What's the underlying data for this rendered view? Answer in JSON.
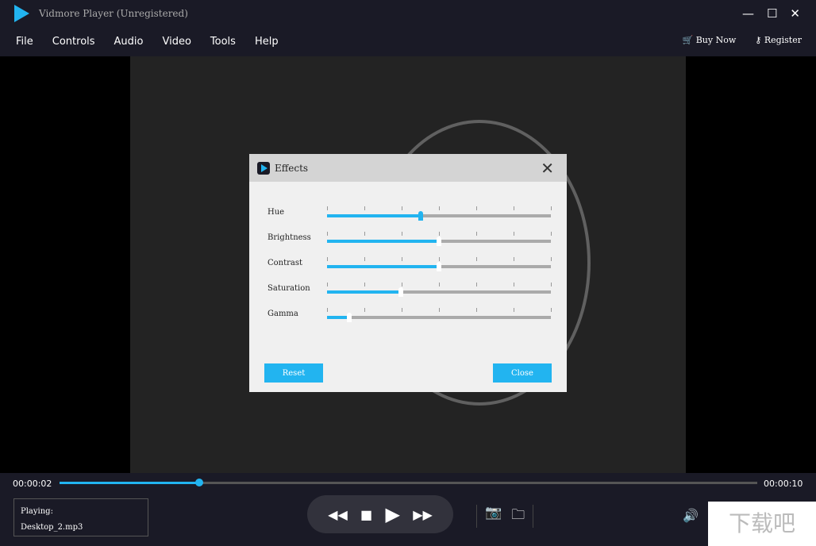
{
  "app": {
    "title": "Vidmore Player (Unregistered)"
  },
  "menu": [
    "File",
    "Controls",
    "Audio",
    "Video",
    "Tools",
    "Help"
  ],
  "menu_right": {
    "buy": "Buy Now",
    "register": "Register"
  },
  "dialog": {
    "title": "Effects",
    "reset": "Reset",
    "close": "Close",
    "sliders": [
      {
        "label": "Hue",
        "value": 42
      },
      {
        "label": "Brightness",
        "value": 50
      },
      {
        "label": "Contrast",
        "value": 50
      },
      {
        "label": "Saturation",
        "value": 33
      },
      {
        "label": "Gamma",
        "value": 10
      }
    ]
  },
  "player": {
    "current": "00:00:02",
    "total": "00:00:10",
    "progress_percent": 20,
    "playing_label": "Playing:",
    "file": "Desktop_2.mp3"
  },
  "watermark": "下载吧",
  "colors": {
    "accent": "#22b4f0"
  }
}
